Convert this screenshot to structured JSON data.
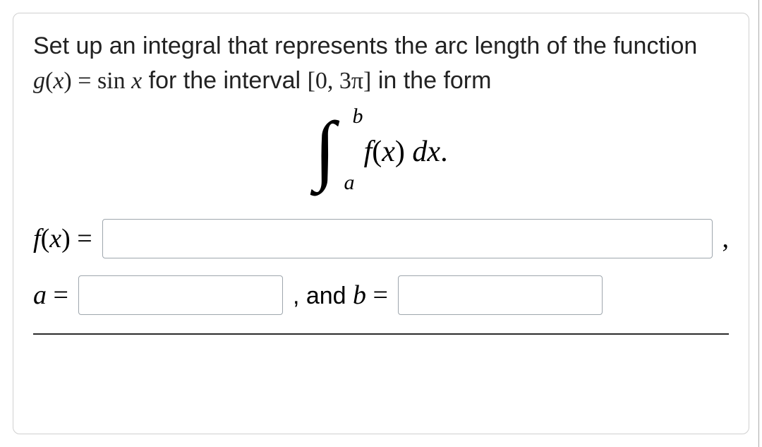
{
  "prompt": {
    "pre": "Set up an integral that represents the arc length of the function ",
    "g_left": "g",
    "g_arg": "x",
    "eq": " = ",
    "g_rhs_sin": "sin",
    "g_rhs_x": " x",
    "mid": " for the interval ",
    "interval": "[0, 3π]",
    "post": " in the form"
  },
  "integral": {
    "upper": "b",
    "lower": "a",
    "f": "f",
    "x": "x",
    "dx": " dx",
    "dot": "."
  },
  "inputs": {
    "fx_label_f": "f",
    "fx_label_x": "x",
    "fx_label_eq": " = ",
    "fx_value": "",
    "fx_trail": ",",
    "a_label": "a",
    "a_eq": " = ",
    "a_value": "",
    "mid_conj": ", and ",
    "b_label": "b",
    "b_eq": " = ",
    "b_value": ""
  }
}
